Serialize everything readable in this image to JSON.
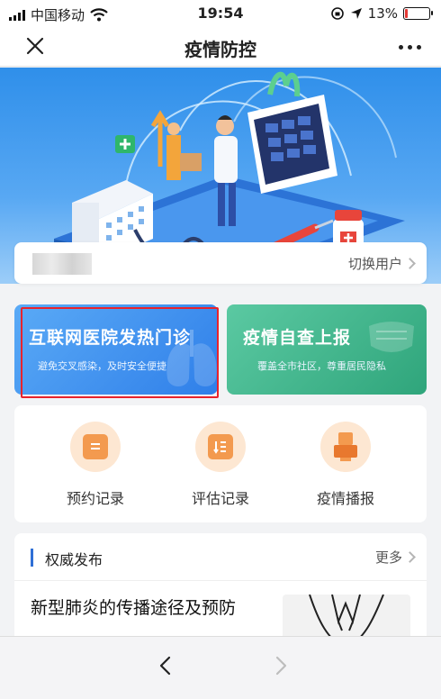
{
  "status_bar": {
    "carrier": "中国移动",
    "time": "19:54",
    "battery_percent": "13%",
    "battery_level": 0.13,
    "icons": [
      "signal-icon",
      "wifi-icon",
      "rotation-lock-icon",
      "location-icon",
      "battery-icon"
    ]
  },
  "nav": {
    "title": "疫情防控",
    "close_icon": "close-icon",
    "more_icon": "more-icon"
  },
  "user": {
    "switch_label": "切换用户"
  },
  "cards": {
    "clinic": {
      "title": "互联网医院发热门诊",
      "subtitle": "避免交叉感染，及时安全便捷"
    },
    "report": {
      "title": "疫情自查上报",
      "subtitle": "覆盖全市社区，尊重居民隐私"
    }
  },
  "records": [
    {
      "label": "预约记录",
      "icon": "appointment-icon"
    },
    {
      "label": "评估记录",
      "icon": "assessment-icon"
    },
    {
      "label": "疫情播报",
      "icon": "broadcast-icon"
    }
  ],
  "news": {
    "section_title": "权威发布",
    "more_label": "更多",
    "article_title": "新型肺炎的传播途径及预防"
  },
  "colors": {
    "blue_card": "#2f7fe9",
    "green_card": "#2fa57b",
    "highlight": "#e8232c",
    "icon_orange": "#f39a4f"
  }
}
